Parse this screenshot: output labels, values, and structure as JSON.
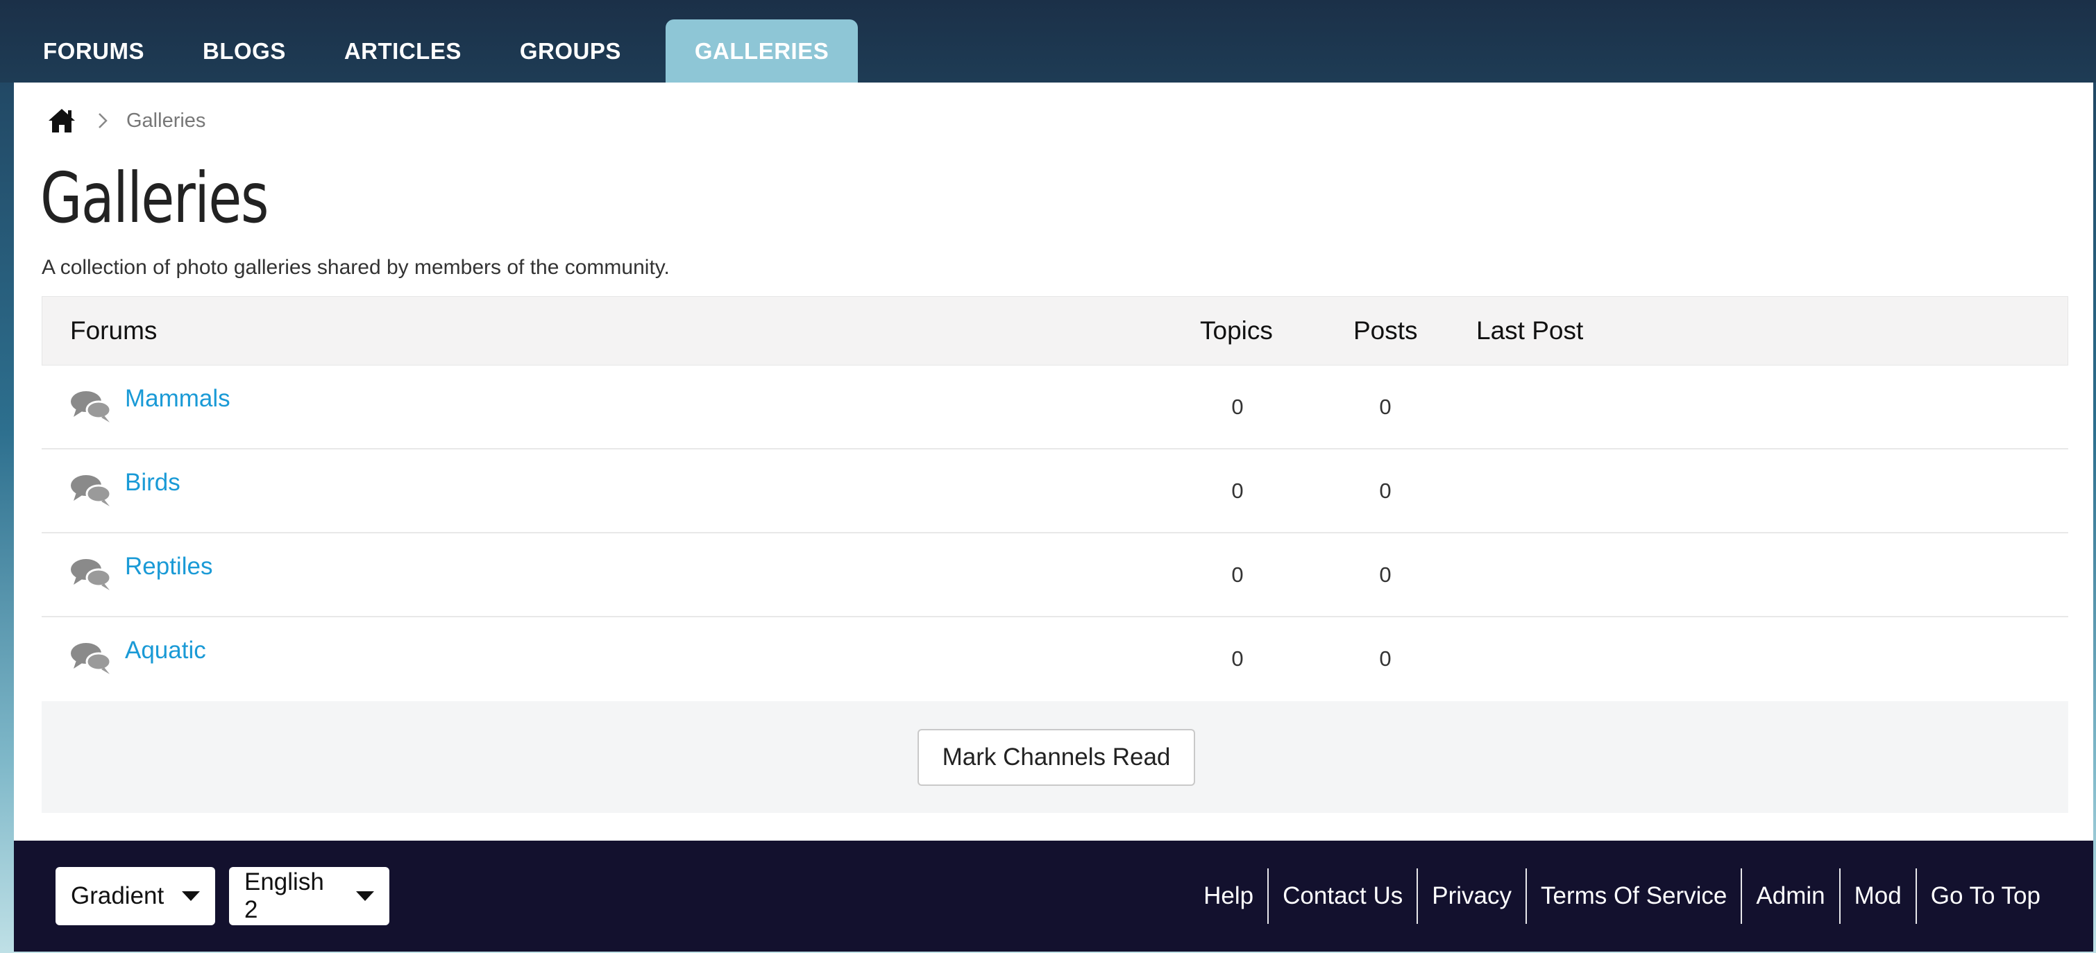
{
  "nav": {
    "tabs": [
      {
        "label": "FORUMS"
      },
      {
        "label": "BLOGS"
      },
      {
        "label": "ARTICLES"
      },
      {
        "label": "GROUPS"
      },
      {
        "label": "GALLERIES",
        "active": true
      }
    ]
  },
  "breadcrumb": {
    "current": "Galleries"
  },
  "page": {
    "title": "Galleries",
    "description": "A collection of photo galleries shared by members of the community."
  },
  "table": {
    "headers": {
      "forums": "Forums",
      "topics": "Topics",
      "posts": "Posts",
      "last_post": "Last Post"
    },
    "rows": [
      {
        "name": "Mammals",
        "topics": "0",
        "posts": "0"
      },
      {
        "name": "Birds",
        "topics": "0",
        "posts": "0"
      },
      {
        "name": "Reptiles",
        "topics": "0",
        "posts": "0"
      },
      {
        "name": "Aquatic",
        "topics": "0",
        "posts": "0"
      }
    ]
  },
  "actions": {
    "mark_read": "Mark Channels Read"
  },
  "footer": {
    "theme_select": "Gradient",
    "language_select": "English 2",
    "links": [
      "Help",
      "Contact Us",
      "Privacy",
      "Terms Of Service",
      "Admin",
      "Mod",
      "Go To Top"
    ]
  },
  "colors": {
    "link": "#1a9ad6",
    "active_tab": "#8ec6d6",
    "footer_bg": "#13112e",
    "header_bg": "#1b3048"
  }
}
